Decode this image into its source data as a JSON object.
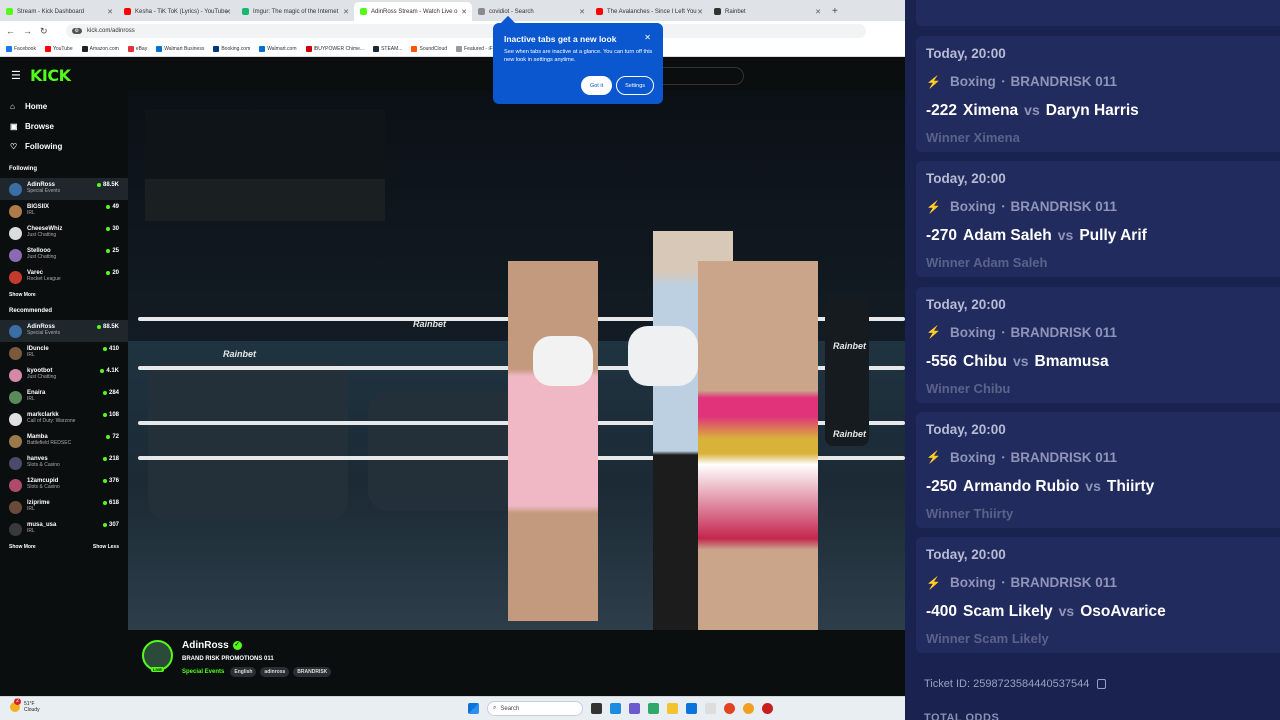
{
  "browser": {
    "tabs": [
      {
        "title": "Stream - Kick Dashboard",
        "color": "#53fc18"
      },
      {
        "title": "Kesha - TiK ToK (Lyrics) - YouTube",
        "color": "#ff0000"
      },
      {
        "title": "Imgur: The magic of the Internet",
        "color": "#1bb76e"
      },
      {
        "title": "AdinRoss Stream - Watch Live o",
        "color": "#53fc18",
        "active": true
      },
      {
        "title": "covidiot - Search",
        "color": "#8a8a8a"
      },
      {
        "title": "The Avalanches - Since I Left You",
        "color": "#ff0000"
      },
      {
        "title": "Rainbet",
        "color": "#333333"
      }
    ],
    "url": "kick.com/adinross",
    "bookmarks": [
      "Facebook",
      "YouTube",
      "Amazon.com",
      "eBay",
      "Walmart Business",
      "Booking.com",
      "Walmart.com",
      "IBUYPOWER Chime...",
      "STEAM...",
      "SoundCloud",
      "Featured - iFunny",
      "Amazon.com Audib..."
    ]
  },
  "popup": {
    "title": "Inactive tabs get a new look",
    "body": "See when tabs are inactive at a glance. You can turn off this new look in settings anytime.",
    "primary": "Got it",
    "secondary": "Settings"
  },
  "kick": {
    "logo": "KICK",
    "nav": [
      {
        "label": "Home",
        "icon": "home-icon"
      },
      {
        "label": "Browse",
        "icon": "browse-icon"
      },
      {
        "label": "Following",
        "icon": "heart-icon"
      }
    ],
    "following_header": "Following",
    "following": [
      {
        "name": "AdinRoss",
        "category": "Special Events",
        "viewers": "88.5K",
        "color": "#3a6ea5",
        "hl": true
      },
      {
        "name": "BIGSIIX",
        "category": "IRL",
        "viewers": "49",
        "color": "#b07b4a"
      },
      {
        "name": "CheeseWhiz",
        "category": "Just Chatting",
        "viewers": "30",
        "color": "#dcdcdc"
      },
      {
        "name": "Stellooo",
        "category": "Just Chatting",
        "viewers": "25",
        "color": "#8a6bb3"
      },
      {
        "name": "Varec",
        "category": "Rocket League",
        "viewers": "20",
        "color": "#c33b2b"
      }
    ],
    "show_more": "Show More",
    "recommended_header": "Recommended",
    "recommended": [
      {
        "name": "AdinRoss",
        "category": "Special Events",
        "viewers": "88.5K",
        "color": "#3a6ea5",
        "hl": true
      },
      {
        "name": "IDuncle",
        "category": "IRL",
        "viewers": "410",
        "color": "#7a5a3a"
      },
      {
        "name": "kyootbot",
        "category": "Just Chatting",
        "viewers": "4.1K",
        "color": "#d48aa6"
      },
      {
        "name": "Enaira",
        "category": "IRL",
        "viewers": "284",
        "color": "#5a8a5a"
      },
      {
        "name": "markclarkk",
        "category": "Call of Duty: Warzone",
        "viewers": "108",
        "color": "#e0e0e0"
      },
      {
        "name": "Mamba",
        "category": "Battlefield REDSEC",
        "viewers": "72",
        "color": "#9a7a4a"
      },
      {
        "name": "hanves",
        "category": "Slots & Casino",
        "viewers": "218",
        "color": "#4a4a6a"
      },
      {
        "name": "12amcupid",
        "category": "Slots & Casino",
        "viewers": "376",
        "color": "#b04a6a"
      },
      {
        "name": "lziprime",
        "category": "IRL",
        "viewers": "618",
        "color": "#6a4a3a"
      },
      {
        "name": "musa_usa",
        "category": "IRL",
        "viewers": "307",
        "color": "#3a3a3a"
      }
    ],
    "show_less": "Show Less"
  },
  "channel": {
    "name": "AdinRoss",
    "live_badge": "LIVE",
    "stream_title": "BRAND RISK PROMOTIONS 011",
    "category": "Special Events",
    "tags": [
      "English",
      "adinross",
      "BRANDRISK"
    ]
  },
  "video": {
    "logo_text": "Rainbet"
  },
  "taskbar": {
    "temp": "51°F",
    "condition": "Cloudy",
    "badge": "2",
    "search": "Search"
  },
  "bets": [
    {
      "date": "Today, 20:00",
      "sport": "Boxing",
      "event": "BRANDRISK 011",
      "odds": "-222",
      "home": "Ximena",
      "away": "Daryn Harris",
      "winner": "Winner Ximena"
    },
    {
      "date": "Today, 20:00",
      "sport": "Boxing",
      "event": "BRANDRISK 011",
      "odds": "-270",
      "home": "Adam Saleh",
      "away": "Pully Arif",
      "winner": "Winner Adam Saleh"
    },
    {
      "date": "Today, 20:00",
      "sport": "Boxing",
      "event": "BRANDRISK 011",
      "odds": "-556",
      "home": "Chibu",
      "away": "Bmamusa",
      "winner": "Winner Chibu"
    },
    {
      "date": "Today, 20:00",
      "sport": "Boxing",
      "event": "BRANDRISK 011",
      "odds": "-250",
      "home": "Armando Rubio",
      "away": "Thiirty",
      "winner": "Winner Thiirty"
    },
    {
      "date": "Today, 20:00",
      "sport": "Boxing",
      "event": "BRANDRISK 011",
      "odds": "-400",
      "home": "Scam Likely",
      "away": "OsoAvarice",
      "winner": "Winner Scam Likely"
    }
  ],
  "bet_vs": "vs",
  "ticket": "Ticket ID: 2598723584440537544",
  "total_odds": "TOTAL ODDS"
}
